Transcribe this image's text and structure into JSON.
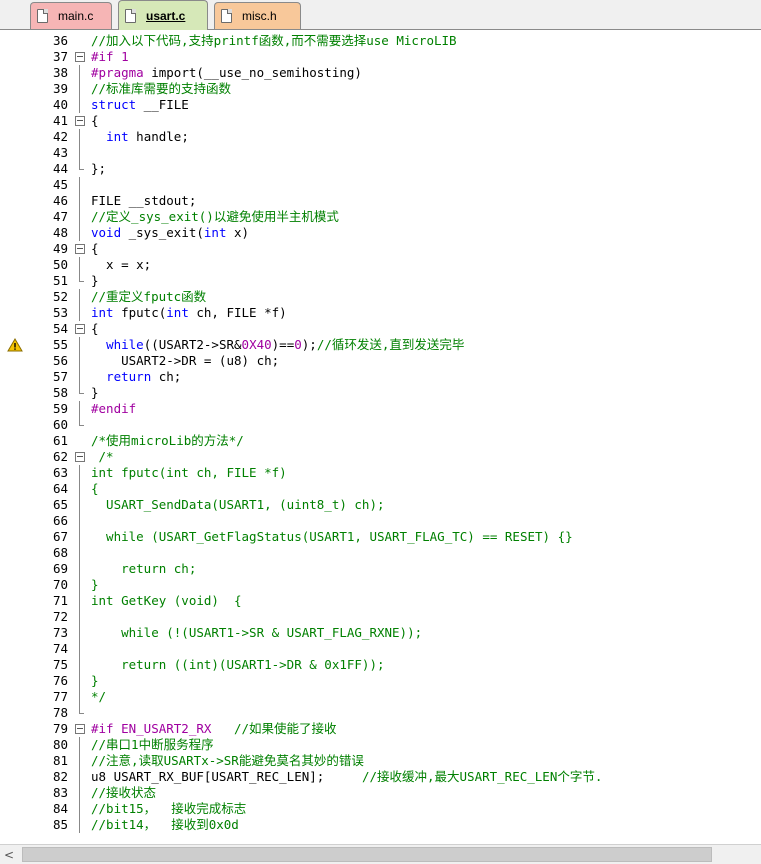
{
  "tabs": [
    {
      "label": "main.c",
      "color": "#f6b5b5",
      "active": false
    },
    {
      "label": "usart.c",
      "color": "#d6e8b8",
      "active": true
    },
    {
      "label": "misc.h",
      "color": "#f8c89a",
      "active": false
    }
  ],
  "editor": {
    "lines": [
      {
        "n": "36",
        "fold": "",
        "segs": [
          {
            "t": "//加入以下代码,支持printf函数,而不需要选择use MicroLIB",
            "c": "comment"
          }
        ]
      },
      {
        "n": "37",
        "fold": "box",
        "segs": [
          {
            "t": "#if 1",
            "c": "pp"
          }
        ]
      },
      {
        "n": "38",
        "fold": "bar",
        "segs": [
          {
            "t": "#pragma",
            "c": "pp"
          },
          {
            "t": " import(__use_no_semihosting)",
            "c": ""
          }
        ]
      },
      {
        "n": "39",
        "fold": "bar",
        "segs": [
          {
            "t": "//标准库需要的支持函数",
            "c": "comment"
          }
        ]
      },
      {
        "n": "40",
        "fold": "bar",
        "segs": [
          {
            "t": "struct",
            "c": "kw"
          },
          {
            "t": " __FILE",
            "c": ""
          }
        ]
      },
      {
        "n": "41",
        "fold": "box",
        "segs": [
          {
            "t": "{",
            "c": ""
          }
        ]
      },
      {
        "n": "42",
        "fold": "bar",
        "segs": [
          {
            "t": "  ",
            "c": ""
          },
          {
            "t": "int",
            "c": "kw"
          },
          {
            "t": " handle;",
            "c": ""
          }
        ]
      },
      {
        "n": "43",
        "fold": "bar",
        "segs": []
      },
      {
        "n": "44",
        "fold": "end",
        "segs": [
          {
            "t": "};",
            "c": ""
          }
        ]
      },
      {
        "n": "45",
        "fold": "bar",
        "segs": []
      },
      {
        "n": "46",
        "fold": "bar",
        "segs": [
          {
            "t": "FILE __stdout;",
            "c": ""
          }
        ]
      },
      {
        "n": "47",
        "fold": "bar",
        "segs": [
          {
            "t": "//定义_sys_exit()以避免使用半主机模式",
            "c": "comment"
          }
        ]
      },
      {
        "n": "48",
        "fold": "bar",
        "segs": [
          {
            "t": "void",
            "c": "kw"
          },
          {
            "t": " _sys_exit(",
            "c": ""
          },
          {
            "t": "int",
            "c": "kw"
          },
          {
            "t": " x)",
            "c": ""
          }
        ]
      },
      {
        "n": "49",
        "fold": "box",
        "segs": [
          {
            "t": "{",
            "c": ""
          }
        ]
      },
      {
        "n": "50",
        "fold": "bar",
        "segs": [
          {
            "t": "  x = x;",
            "c": ""
          }
        ]
      },
      {
        "n": "51",
        "fold": "end",
        "segs": [
          {
            "t": "}",
            "c": ""
          }
        ]
      },
      {
        "n": "52",
        "fold": "bar",
        "segs": [
          {
            "t": "//重定义fputc函数",
            "c": "comment"
          }
        ]
      },
      {
        "n": "53",
        "fold": "bar",
        "segs": [
          {
            "t": "int",
            "c": "kw"
          },
          {
            "t": " fputc(",
            "c": ""
          },
          {
            "t": "int",
            "c": "kw"
          },
          {
            "t": " ch, FILE *f)",
            "c": ""
          }
        ]
      },
      {
        "n": "54",
        "fold": "box",
        "segs": [
          {
            "t": "{",
            "c": ""
          }
        ]
      },
      {
        "n": "55",
        "fold": "bar",
        "warn": true,
        "segs": [
          {
            "t": "  ",
            "c": ""
          },
          {
            "t": "while",
            "c": "kw"
          },
          {
            "t": "((USART2->SR&",
            "c": ""
          },
          {
            "t": "0X40",
            "c": "num"
          },
          {
            "t": ")==",
            "c": ""
          },
          {
            "t": "0",
            "c": "num"
          },
          {
            "t": ");",
            "c": ""
          },
          {
            "t": "//循环发送,直到发送完毕",
            "c": "comment"
          }
        ]
      },
      {
        "n": "56",
        "fold": "bar",
        "segs": [
          {
            "t": "    USART2->DR = (u8) ch;",
            "c": ""
          }
        ]
      },
      {
        "n": "57",
        "fold": "bar",
        "segs": [
          {
            "t": "  ",
            "c": ""
          },
          {
            "t": "return",
            "c": "kw"
          },
          {
            "t": " ch;",
            "c": ""
          }
        ]
      },
      {
        "n": "58",
        "fold": "end",
        "segs": [
          {
            "t": "}",
            "c": ""
          }
        ]
      },
      {
        "n": "59",
        "fold": "bar",
        "segs": [
          {
            "t": "#endif",
            "c": "pp"
          }
        ]
      },
      {
        "n": "60",
        "fold": "end",
        "segs": []
      },
      {
        "n": "61",
        "fold": "",
        "segs": [
          {
            "t": "/*使用microLib的方法*/",
            "c": "comment"
          }
        ]
      },
      {
        "n": "62",
        "fold": "box",
        "segs": [
          {
            "t": " /*",
            "c": "comment"
          }
        ]
      },
      {
        "n": "63",
        "fold": "bar",
        "segs": [
          {
            "t": "int fputc(int ch, FILE *f)",
            "c": "comment"
          }
        ]
      },
      {
        "n": "64",
        "fold": "bar",
        "segs": [
          {
            "t": "{",
            "c": "comment"
          }
        ]
      },
      {
        "n": "65",
        "fold": "bar",
        "segs": [
          {
            "t": "  USART_SendData(USART1, (uint8_t) ch);",
            "c": "comment"
          }
        ]
      },
      {
        "n": "66",
        "fold": "bar",
        "segs": []
      },
      {
        "n": "67",
        "fold": "bar",
        "segs": [
          {
            "t": "  while (USART_GetFlagStatus(USART1, USART_FLAG_TC) == RESET) {}",
            "c": "comment"
          }
        ]
      },
      {
        "n": "68",
        "fold": "bar",
        "segs": []
      },
      {
        "n": "69",
        "fold": "bar",
        "segs": [
          {
            "t": "    return ch;",
            "c": "comment"
          }
        ]
      },
      {
        "n": "70",
        "fold": "bar",
        "segs": [
          {
            "t": "}",
            "c": "comment"
          }
        ]
      },
      {
        "n": "71",
        "fold": "bar",
        "segs": [
          {
            "t": "int GetKey (void)  {",
            "c": "comment"
          }
        ]
      },
      {
        "n": "72",
        "fold": "bar",
        "segs": []
      },
      {
        "n": "73",
        "fold": "bar",
        "segs": [
          {
            "t": "    while (!(USART1->SR & USART_FLAG_RXNE));",
            "c": "comment"
          }
        ]
      },
      {
        "n": "74",
        "fold": "bar",
        "segs": []
      },
      {
        "n": "75",
        "fold": "bar",
        "segs": [
          {
            "t": "    return ((int)(USART1->DR & 0x1FF));",
            "c": "comment"
          }
        ]
      },
      {
        "n": "76",
        "fold": "bar",
        "segs": [
          {
            "t": "}",
            "c": "comment"
          }
        ]
      },
      {
        "n": "77",
        "fold": "bar",
        "segs": [
          {
            "t": "*/",
            "c": "comment"
          }
        ]
      },
      {
        "n": "78",
        "fold": "end",
        "segs": []
      },
      {
        "n": "79",
        "fold": "box",
        "segs": [
          {
            "t": "#if EN_USART2_RX",
            "c": "pp"
          },
          {
            "t": "   ",
            "c": ""
          },
          {
            "t": "//如果使能了接收",
            "c": "comment"
          }
        ]
      },
      {
        "n": "80",
        "fold": "bar",
        "segs": [
          {
            "t": "//串口1中断服务程序",
            "c": "comment"
          }
        ]
      },
      {
        "n": "81",
        "fold": "bar",
        "segs": [
          {
            "t": "//注意,读取USARTx->SR能避免莫名其妙的错误",
            "c": "comment"
          }
        ]
      },
      {
        "n": "82",
        "fold": "bar",
        "segs": [
          {
            "t": "u8 USART_RX_BUF[USART_REC_LEN];     ",
            "c": ""
          },
          {
            "t": "//接收缓冲,最大USART_REC_LEN个字节.",
            "c": "comment"
          }
        ]
      },
      {
        "n": "83",
        "fold": "bar",
        "segs": [
          {
            "t": "//接收状态",
            "c": "comment"
          }
        ]
      },
      {
        "n": "84",
        "fold": "bar",
        "segs": [
          {
            "t": "//bit15，  接收完成标志",
            "c": "comment"
          }
        ]
      },
      {
        "n": "85",
        "fold": "bar",
        "segs": [
          {
            "t": "//bit14，  接收到0x0d",
            "c": "comment"
          }
        ]
      }
    ]
  },
  "scrollbar": {
    "left_arrow": "<"
  }
}
